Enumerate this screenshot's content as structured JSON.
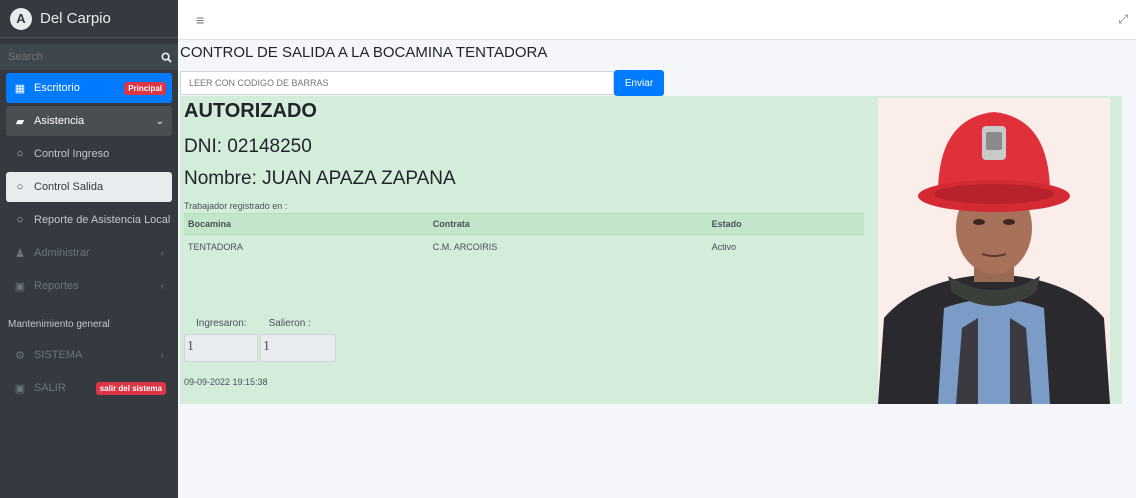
{
  "brand": {
    "name": "Del Carpio",
    "logo_letter": "A"
  },
  "search": {
    "placeholder": "Search"
  },
  "sidebar": {
    "items": [
      {
        "label": "Escritorio",
        "badge": "Principal",
        "icon": "table-icon"
      },
      {
        "label": "Asistencia",
        "icon": "people-icon"
      },
      {
        "label": "Control Ingreso",
        "icon": "circle-icon"
      },
      {
        "label": "Control Salida",
        "icon": "circle-icon"
      },
      {
        "label": "Reporte de Asistencia Local",
        "icon": "circle-icon"
      },
      {
        "label": "Administrar",
        "icon": "user-icon"
      },
      {
        "label": "Reportes",
        "icon": "chart-icon"
      }
    ],
    "header": "Mantenimiento general",
    "sistema": {
      "label": "SISTEMA",
      "icon": "gear-icon"
    },
    "salir": {
      "label": "SALIR",
      "badge": "salir del sistema",
      "icon": "exit-icon"
    }
  },
  "main": {
    "title": "CONTROL DE SALIDA A LA BOCAMINA TENTADORA",
    "barcode_placeholder": "LEER CON CODIGO DE BARRAS",
    "send_label": "Enviar",
    "status": "AUTORIZADO",
    "dni": "DNI: 02148250",
    "nombre": "Nombre: JUAN APAZA ZAPANA",
    "registrado": "Trabajador registrado en :",
    "table": {
      "headers": [
        "Bocamina",
        "Contrata",
        "Estado"
      ],
      "rows": [
        [
          "TENTADORA",
          "C.M. ARCOIRIS",
          "Activo"
        ]
      ]
    },
    "ingresaron_label": "Ingresaron:",
    "salieron_label": "Salieron :",
    "ingresaron_value": "1",
    "salieron_value": "1",
    "timestamp": "09-09-2022 19:15:38"
  },
  "colors": {
    "sidebar": "#343a40",
    "active": "#007bff",
    "success_bg": "#d4edda",
    "badge": "#dc3545",
    "helmet": "#e0303a"
  }
}
